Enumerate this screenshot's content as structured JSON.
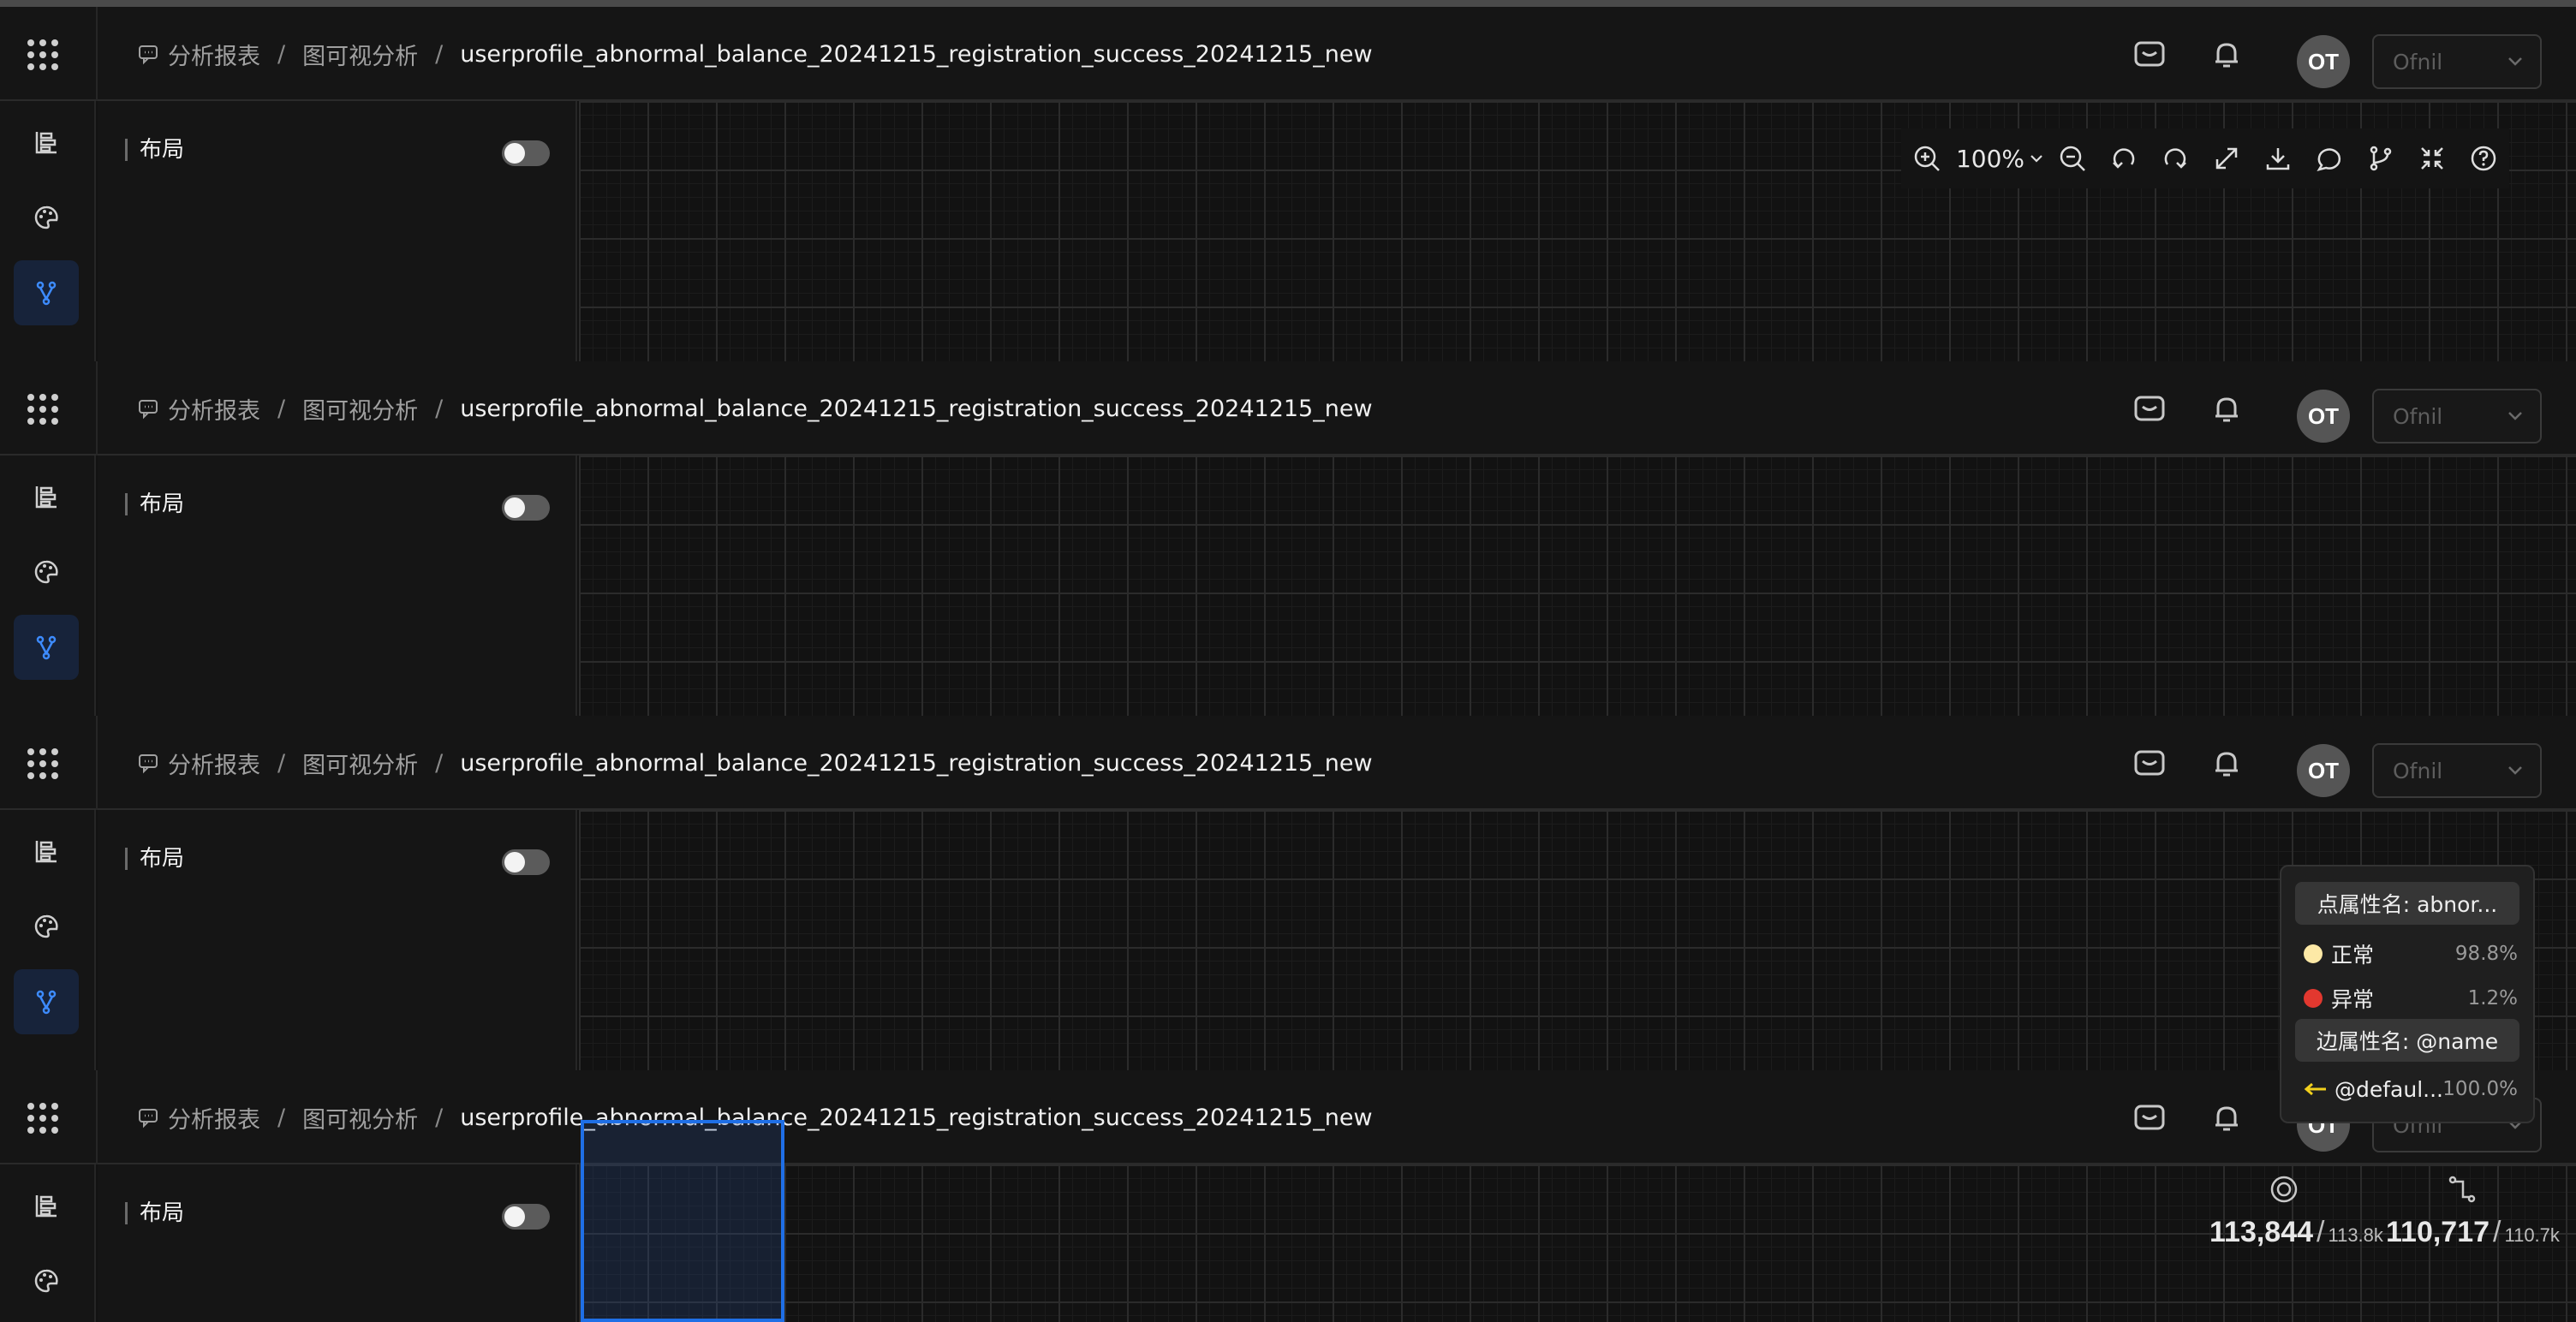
{
  "header": {
    "breadcrumb": [
      "分析报表",
      "图可视分析",
      "userprofile_abnormal_balance_20241215_registration_success_20241215_new"
    ],
    "avatar_initials": "OT",
    "org_select_value": "Ofnil"
  },
  "sidebar": {
    "icons": [
      "hierarchy-icon",
      "palette-icon",
      "graph-branch-icon"
    ],
    "active": "graph-branch-icon"
  },
  "panel": {
    "title": "布局",
    "toggle_on": false
  },
  "toolbar": {
    "zoom_label": "100%",
    "icons": [
      "zoom-in-icon",
      "zoom-out-icon",
      "undo-icon",
      "redo-icon",
      "fit-view-icon",
      "download-icon",
      "comment-icon",
      "branch-icon",
      "fullscreen-icon",
      "help-icon"
    ]
  },
  "legend": {
    "node_header": "点属性名: abnor...",
    "node_items": [
      {
        "label": "正常",
        "percent": "98.8%",
        "color": "#fde9a6"
      },
      {
        "label": "异常",
        "percent": "1.2%",
        "color": "#e2382f"
      }
    ],
    "edge_header": "边属性名: @name",
    "edge_items": [
      {
        "label": "@defaul...",
        "percent": "100.0%",
        "color": "#f2d01d"
      }
    ]
  },
  "stats": {
    "nodes": {
      "count": "113,844",
      "total": "113.8k"
    },
    "edges": {
      "count": "110,717",
      "total": "110.7k"
    }
  },
  "colors": {
    "accent": "#1f6fe6",
    "background": "#121212"
  }
}
